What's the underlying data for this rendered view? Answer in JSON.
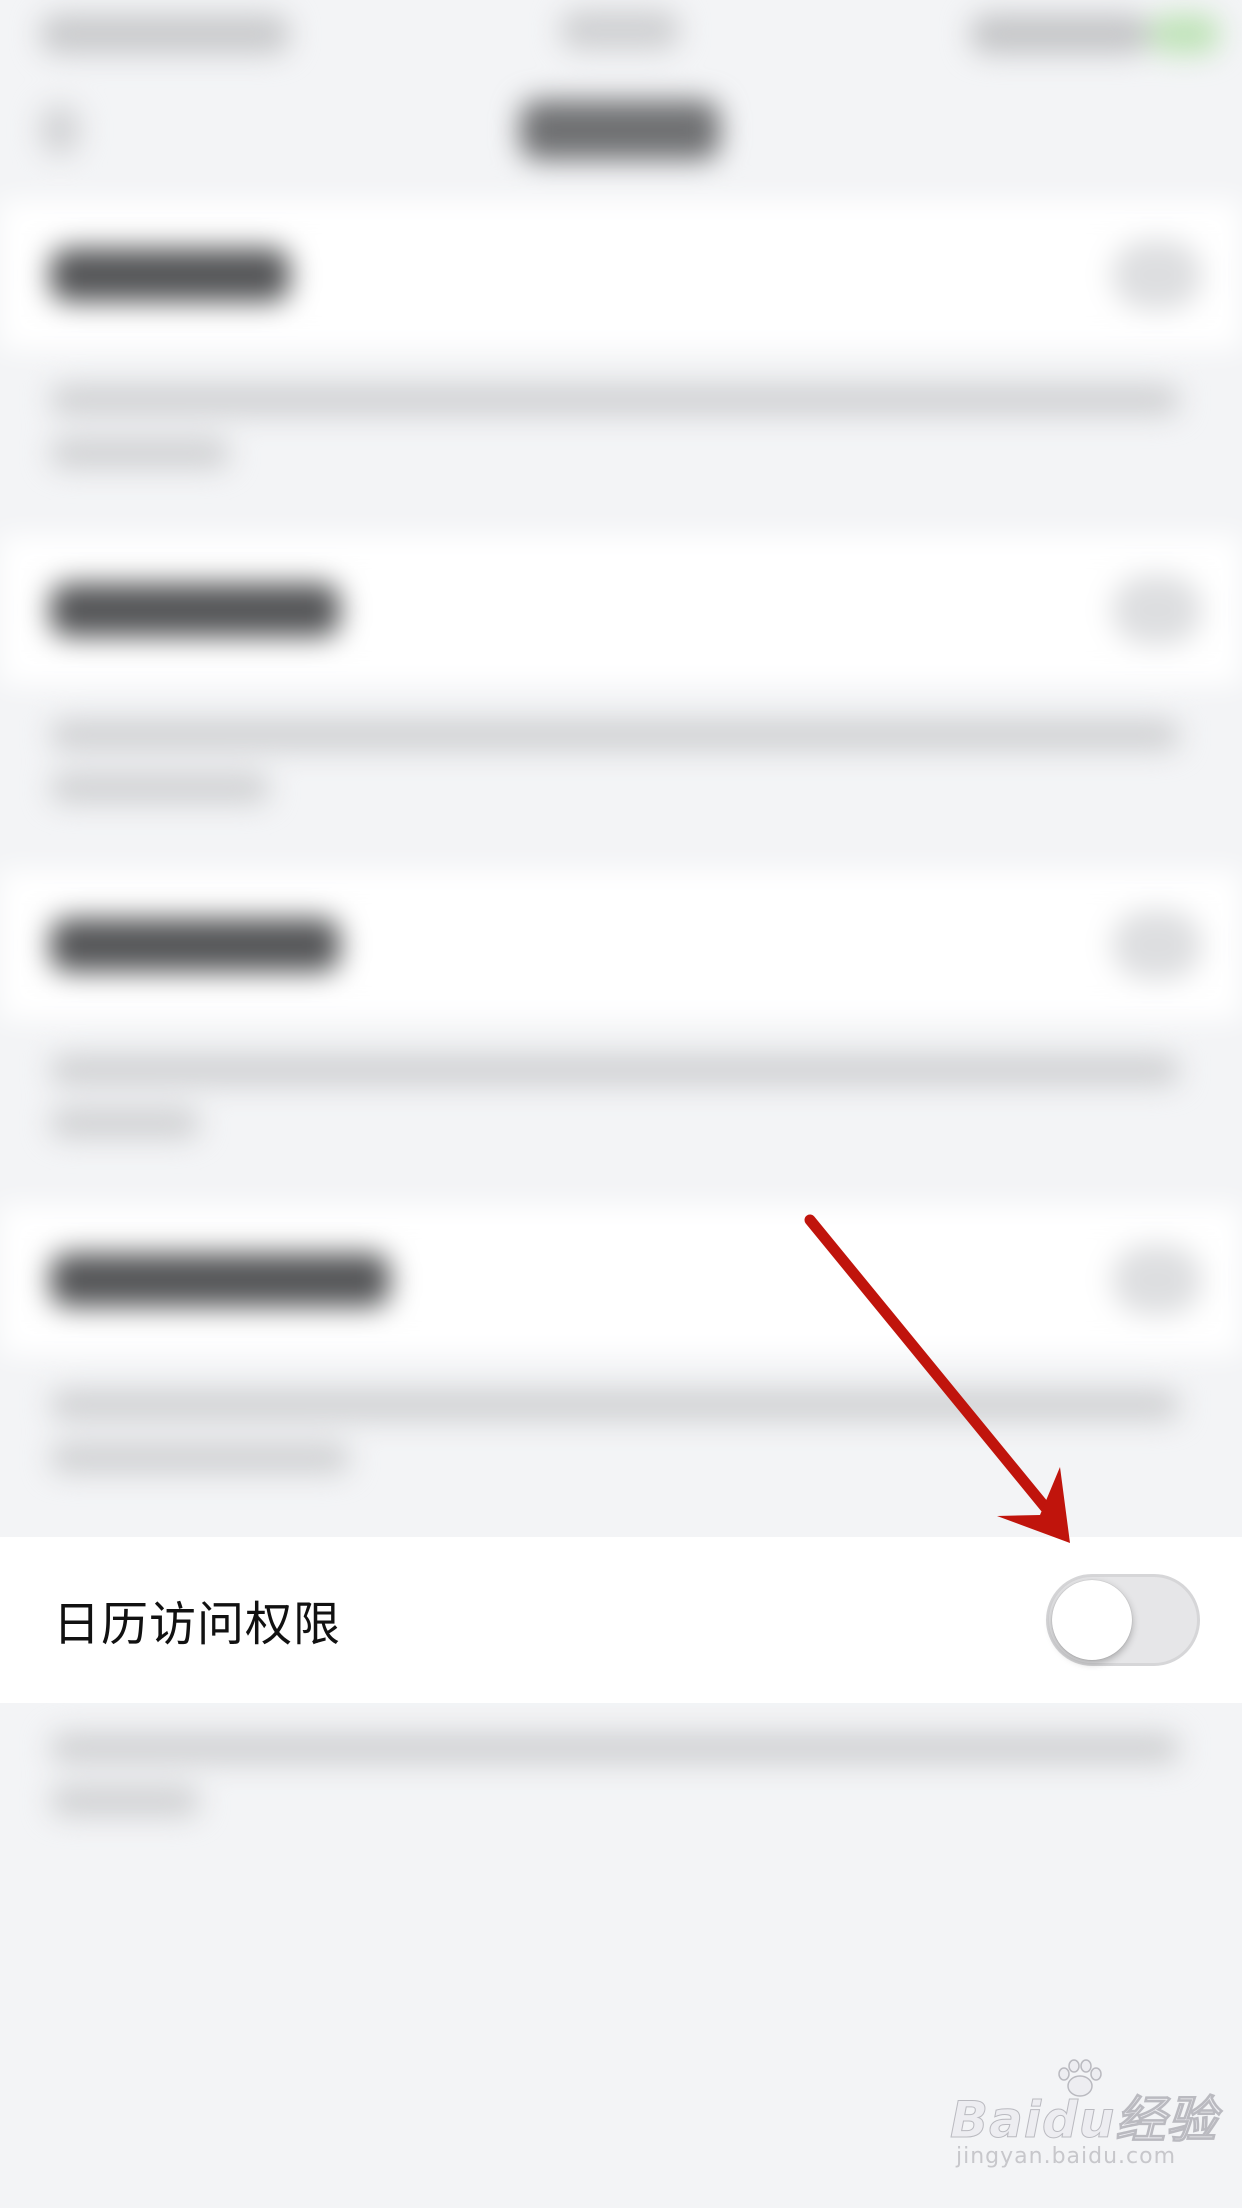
{
  "setting": {
    "label": "日历访问权限",
    "enabled": false
  },
  "watermark": {
    "brand": "Baidu经验",
    "url": "jingyan.baidu.com"
  },
  "colors": {
    "background": "#f3f4f6",
    "row_background": "#ffffff",
    "toggle_off_track": "#e6e6e8",
    "annotation_arrow": "#c0140c"
  },
  "icons": {
    "annotation": "red-arrow-icon",
    "watermark": "paw-icon"
  }
}
